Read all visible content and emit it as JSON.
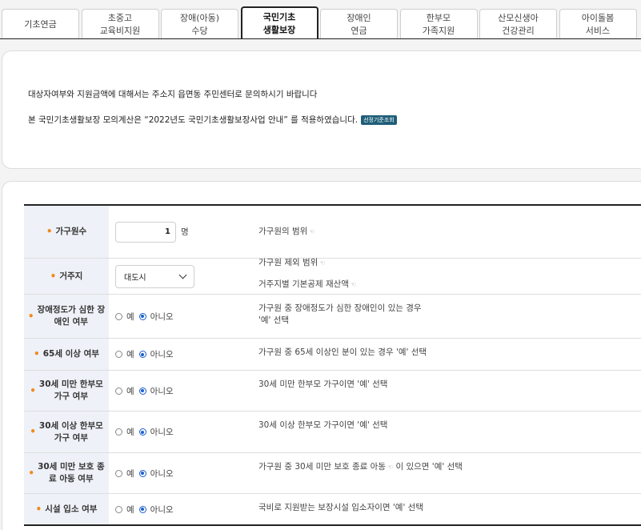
{
  "tabs": [
    {
      "label": "기초연금",
      "active": false
    },
    {
      "label": "초중고\n교육비지원",
      "active": false
    },
    {
      "label": "장애(아동)\n수당",
      "active": false
    },
    {
      "label": "국민기초\n생활보장",
      "active": true
    },
    {
      "label": "장애인\n연금",
      "active": false
    },
    {
      "label": "한부모\n가족지원",
      "active": false
    },
    {
      "label": "산모신생아\n건강관리",
      "active": false
    },
    {
      "label": "아이돌봄\n서비스",
      "active": false
    }
  ],
  "notice": {
    "line1": "대상자여부와 지원금액에 대해서는 주소지 읍면동 주민센터로 문의하시기 바랍니다",
    "line2": "본 국민기초생활보장 모의계산은 “2022년도 국민기초생활보장사업 안내” 를 적용하였습니다.",
    "badge": "선정기준조회"
  },
  "form": {
    "household": {
      "label": "가구원수",
      "value": "1",
      "unit": "명",
      "link1": "가구원의 범위",
      "link2": "가구원 제외 범위"
    },
    "residence": {
      "label": "거주지",
      "selected": "대도시",
      "link": "거주지별 기본공제 재산액"
    },
    "yes": "예",
    "no": "아니오",
    "rows": [
      {
        "label": "장애정도가 심한 장\n애인 여부",
        "desc": "가구원 중 장애정도가 심한 장애인이 있는 경우\n'예' 선택"
      },
      {
        "label": "65세 이상 여부",
        "desc": "가구원 중 65세 이상인 분이 있는 경우 '예' 선택"
      },
      {
        "label": "30세 미만 한부모\n가구 여부",
        "desc": "30세 미만 한부모 가구이면 '예' 선택"
      },
      {
        "label": "30세 이상 한부모\n가구 여부",
        "desc": "30세 이상 한부모 가구이면 '예' 선택"
      },
      {
        "label": "30세 미만 보호 종\n료 아동 여부",
        "desc_pre": "가구원 중 ",
        "desc_link": "30세 미만 보호 종료 아동",
        "desc_post": " 이 있으면 '예' 선택"
      },
      {
        "label": "시설 입소 여부",
        "desc": "국비로 지원받는 보장시설 입소자이면 '예' 선택"
      }
    ]
  }
}
